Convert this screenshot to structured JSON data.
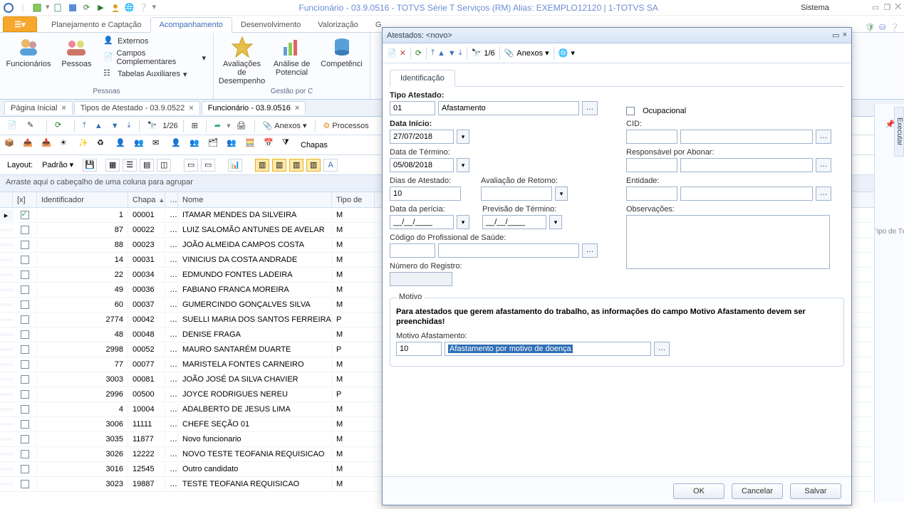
{
  "window": {
    "title": "Funcionário - 03.9.0516 - TOTVS Série T Serviços (RM) Alias: EXEMPLO12120 | 1-TOTVS SA",
    "sys_label": "Sistema"
  },
  "ribbon": {
    "main_tabs": [
      "Planejamento e Captação",
      "Acompanhamento",
      "Desenvolvimento",
      "Valorização",
      "G"
    ],
    "selected_tab": 1,
    "group_pessoas": {
      "caption": "Pessoas",
      "funcionarios": "Funcionários",
      "pessoas": "Pessoas",
      "externos": "Externos",
      "campos_comp": "Campos Complementares",
      "tabelas_aux": "Tabelas Auxiliares"
    },
    "btn_avaliacoes": "Avaliações de\nDesempenho",
    "btn_analise": "Análise de\nPotencial",
    "btn_competencias": "Competênci",
    "group_gestao": "Gestão por C"
  },
  "doc_tabs": {
    "t1": "Página Inicial",
    "t2": "Tipos de Atestado - 03.9.0522",
    "t3": "Funcionário - 03.9.0516"
  },
  "toolbar": {
    "counter": "1/26",
    "anexos": "Anexos",
    "processos": "Processos",
    "chapas_label": "Chapas"
  },
  "layout_row": {
    "label": "Layout:",
    "value": "Padrão"
  },
  "groupby_text": "Arraste aqui o cabeçalho de uma coluna para agrupar",
  "grid": {
    "headers": {
      "chk": "[x]",
      "id": "Identificador",
      "chapa": "Chapa",
      "nome": "Nome",
      "tipo": "Tipo de"
    },
    "rows": [
      {
        "checked": true,
        "id": "1",
        "chapa": "00001",
        "nome": "ITAMAR MENDES DA SILVEIRA",
        "tipo": "M"
      },
      {
        "checked": false,
        "id": "87",
        "chapa": "00022",
        "nome": "LUIZ SALOMÃO ANTUNES DE AVELAR",
        "tipo": "M"
      },
      {
        "checked": false,
        "id": "88",
        "chapa": "00023",
        "nome": "JOÃO ALMEIDA CAMPOS COSTA",
        "tipo": "M"
      },
      {
        "checked": false,
        "id": "14",
        "chapa": "00031",
        "nome": "VINICIUS DA COSTA ANDRADE",
        "tipo": "M"
      },
      {
        "checked": false,
        "id": "22",
        "chapa": "00034",
        "nome": "EDMUNDO FONTES LADEIRA",
        "tipo": "M"
      },
      {
        "checked": false,
        "id": "49",
        "chapa": "00036",
        "nome": "FABIANO FRANCA MOREIRA",
        "tipo": "M"
      },
      {
        "checked": false,
        "id": "60",
        "chapa": "00037",
        "nome": "GUMERCINDO GONÇALVES SILVA",
        "tipo": "M"
      },
      {
        "checked": false,
        "id": "2774",
        "chapa": "00042",
        "nome": "SUELLI MARIA DOS SANTOS FERREIRA",
        "tipo": "P"
      },
      {
        "checked": false,
        "id": "48",
        "chapa": "00048",
        "nome": "DENISE FRAGA",
        "tipo": "M"
      },
      {
        "checked": false,
        "id": "2998",
        "chapa": "00052",
        "nome": "MAURO SANTARÉM DUARTE",
        "tipo": "P"
      },
      {
        "checked": false,
        "id": "77",
        "chapa": "00077",
        "nome": "MARISTELA FONTES CARNEIRO",
        "tipo": "M"
      },
      {
        "checked": false,
        "id": "3003",
        "chapa": "00081",
        "nome": "JOÃO JOSÉ DA SILVA CHAVIER",
        "tipo": "M"
      },
      {
        "checked": false,
        "id": "2996",
        "chapa": "00500",
        "nome": "JOYCE RODRIGUES NEREU",
        "tipo": "P"
      },
      {
        "checked": false,
        "id": "4",
        "chapa": "10004",
        "nome": "ADALBERTO DE JESUS LIMA",
        "tipo": "M"
      },
      {
        "checked": false,
        "id": "3006",
        "chapa": "11111",
        "nome": "CHEFE SEÇÃO 01",
        "tipo": "M"
      },
      {
        "checked": false,
        "id": "3035",
        "chapa": "11877",
        "nome": "Novo funcionario",
        "tipo": "M"
      },
      {
        "checked": false,
        "id": "3026",
        "chapa": "12222",
        "nome": "NOVO TESTE TEOFANIA REQUISICAO",
        "tipo": "M"
      },
      {
        "checked": false,
        "id": "3016",
        "chapa": "12545",
        "nome": "Outro candidato",
        "tipo": "M"
      },
      {
        "checked": false,
        "id": "3023",
        "chapa": "19887",
        "nome": "TESTE TEOFANIA REQUISICAO",
        "tipo": "M"
      }
    ]
  },
  "dialog": {
    "title": "Atestados: <novo>",
    "counter": "1/6",
    "anexos": "Anexos",
    "tab_ident": "Identificação",
    "labels": {
      "tipo_atestado": "Tipo Atestado:",
      "data_inicio": "Data Início:",
      "data_termino": "Data de Término:",
      "dias_atestado": "Dias de Atestado:",
      "avaliacao_retorno": "Avaliação de Retorno:",
      "data_pericia": "Data da perícia:",
      "previsao_termino": "Previsão de Término:",
      "codigo_prof": "Código do Profissional de Saúde:",
      "num_registro": "Número do Registro:",
      "ocupacional": "Ocupacional",
      "cid": "CID:",
      "responsavel": "Responsável por Abonar:",
      "entidade": "Entidade:",
      "observacoes": "Observações:",
      "motivo_legend": "Motivo",
      "motivo_warning": "Para atestados que gerem afastamento do trabalho, as informações do campo Motivo Afastamento devem ser preenchidas!",
      "motivo_afast": "Motivo Afastamento:"
    },
    "values": {
      "tipo_code": "01",
      "tipo_desc": "Afastamento",
      "data_inicio": "27/07/2018",
      "data_termino": "05/08/2018",
      "dias_atestado": "10",
      "data_pericia": "__/__/____",
      "previsao_termino": "__/__/____",
      "motivo_code": "10",
      "motivo_desc": "Afastamento por motivo de doença"
    },
    "buttons": {
      "ok": "OK",
      "cancelar": "Cancelar",
      "salvar": "Salvar"
    }
  },
  "far_right_snip": "'ipo de Té"
}
